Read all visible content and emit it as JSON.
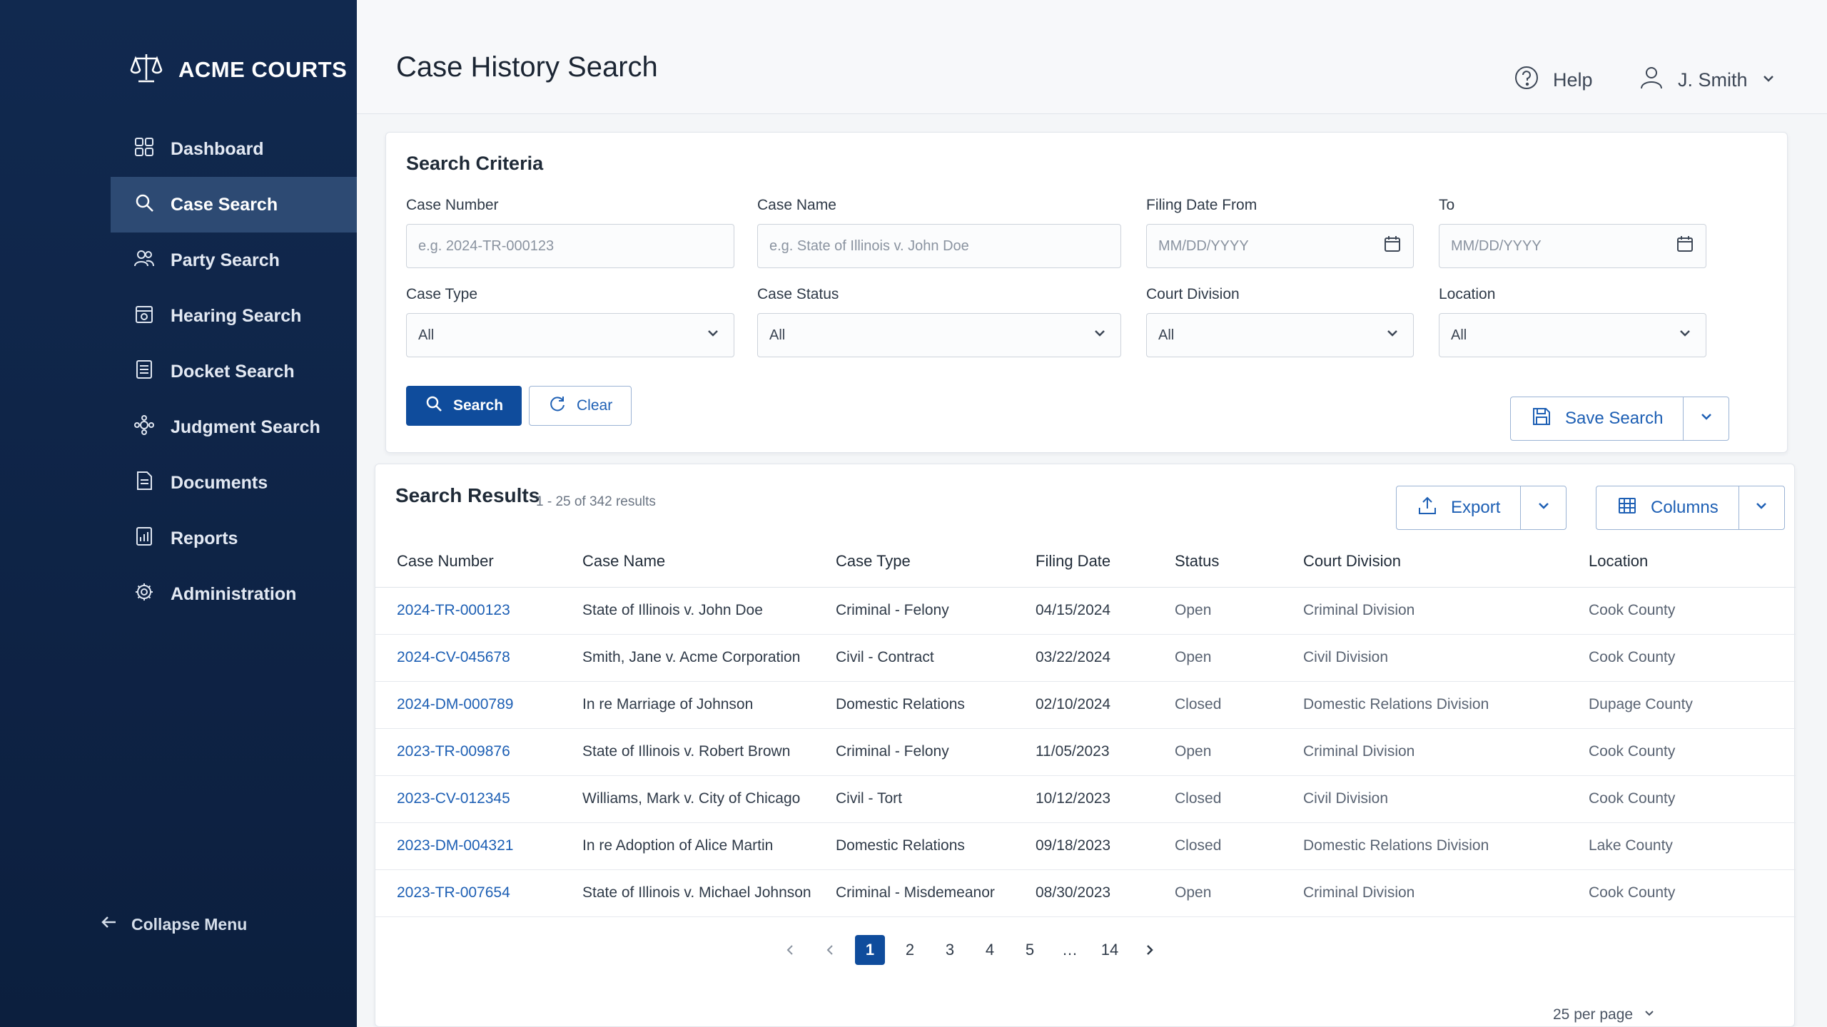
{
  "brand": {
    "name": "ACME COURTS",
    "icon": "scales-icon"
  },
  "sidebar": {
    "items": [
      {
        "label": "Dashboard",
        "icon": "dashboard-icon"
      },
      {
        "label": "Case Search",
        "icon": "search-icon",
        "active": true
      },
      {
        "label": "Party Search",
        "icon": "people-icon"
      },
      {
        "label": "Hearing Search",
        "icon": "calendar-icon"
      },
      {
        "label": "Docket Search",
        "icon": "list-icon"
      },
      {
        "label": "Judgment Search",
        "icon": "gavel-icon"
      },
      {
        "label": "Documents",
        "icon": "document-icon"
      },
      {
        "label": "Reports",
        "icon": "report-icon"
      },
      {
        "label": "Administration",
        "icon": "gear-icon"
      }
    ],
    "collapse_label": "Collapse Menu"
  },
  "header": {
    "title": "Case History Search",
    "help_label": "Help",
    "user_name": "J. Smith"
  },
  "criteria": {
    "title": "Search Criteria",
    "case_number": {
      "label": "Case Number",
      "placeholder": "e.g. 2024-TR-000123"
    },
    "case_name": {
      "label": "Case Name",
      "placeholder": "e.g. State of Illinois v. John Doe"
    },
    "filing_from": {
      "label": "Filing Date From",
      "placeholder": "MM/DD/YYYY"
    },
    "filing_to": {
      "label": "To",
      "placeholder": "MM/DD/YYYY"
    },
    "case_type": {
      "label": "Case Type",
      "value": "All"
    },
    "case_status": {
      "label": "Case Status",
      "value": "All"
    },
    "court_division": {
      "label": "Court Division",
      "value": "All"
    },
    "location": {
      "label": "Location",
      "value": "All"
    },
    "search_label": "Search",
    "clear_label": "Clear",
    "save_search_label": "Save Search"
  },
  "results": {
    "title": "Search Results",
    "count": "1 - 25 of 342 results",
    "export_label": "Export",
    "columns_label": "Columns",
    "headers": [
      "Case Number",
      "Case Name",
      "Case Type",
      "Filing Date",
      "Status",
      "Court Division",
      "Location"
    ],
    "rows": [
      [
        "2024-TR-000123",
        "State of Illinois v. John Doe",
        "Criminal - Felony",
        "04/15/2024",
        "Open",
        "Criminal Division",
        "Cook County"
      ],
      [
        "2024-CV-045678",
        "Smith, Jane v. Acme Corporation",
        "Civil - Contract",
        "03/22/2024",
        "Open",
        "Civil Division",
        "Cook County"
      ],
      [
        "2024-DM-000789",
        "In re Marriage of Johnson",
        "Domestic Relations",
        "02/10/2024",
        "Closed",
        "Domestic Relations Division",
        "Dupage County"
      ],
      [
        "2023-TR-009876",
        "State of Illinois v. Robert Brown",
        "Criminal - Felony",
        "11/05/2023",
        "Open",
        "Criminal Division",
        "Cook County"
      ],
      [
        "2023-CV-012345",
        "Williams, Mark v. City of Chicago",
        "Civil - Tort",
        "10/12/2023",
        "Closed",
        "Civil Division",
        "Cook County"
      ],
      [
        "2023-DM-004321",
        "In re Adoption of Alice Martin",
        "Domestic Relations",
        "09/18/2023",
        "Closed",
        "Domestic Relations Division",
        "Lake County"
      ],
      [
        "2023-TR-007654",
        "State of Illinois v. Michael Johnson",
        "Criminal - Misdemeanor",
        "08/30/2023",
        "Open",
        "Criminal Division",
        "Cook County"
      ]
    ],
    "pagination": {
      "pages": [
        "1",
        "2",
        "3",
        "4",
        "5"
      ],
      "ellipsis": "…",
      "last": "14",
      "current": "1"
    },
    "per_page": "25 per page"
  },
  "colors": {
    "sidebar": "#11294f",
    "accent": "#0f4c9c",
    "link": "#1d5fb4"
  }
}
